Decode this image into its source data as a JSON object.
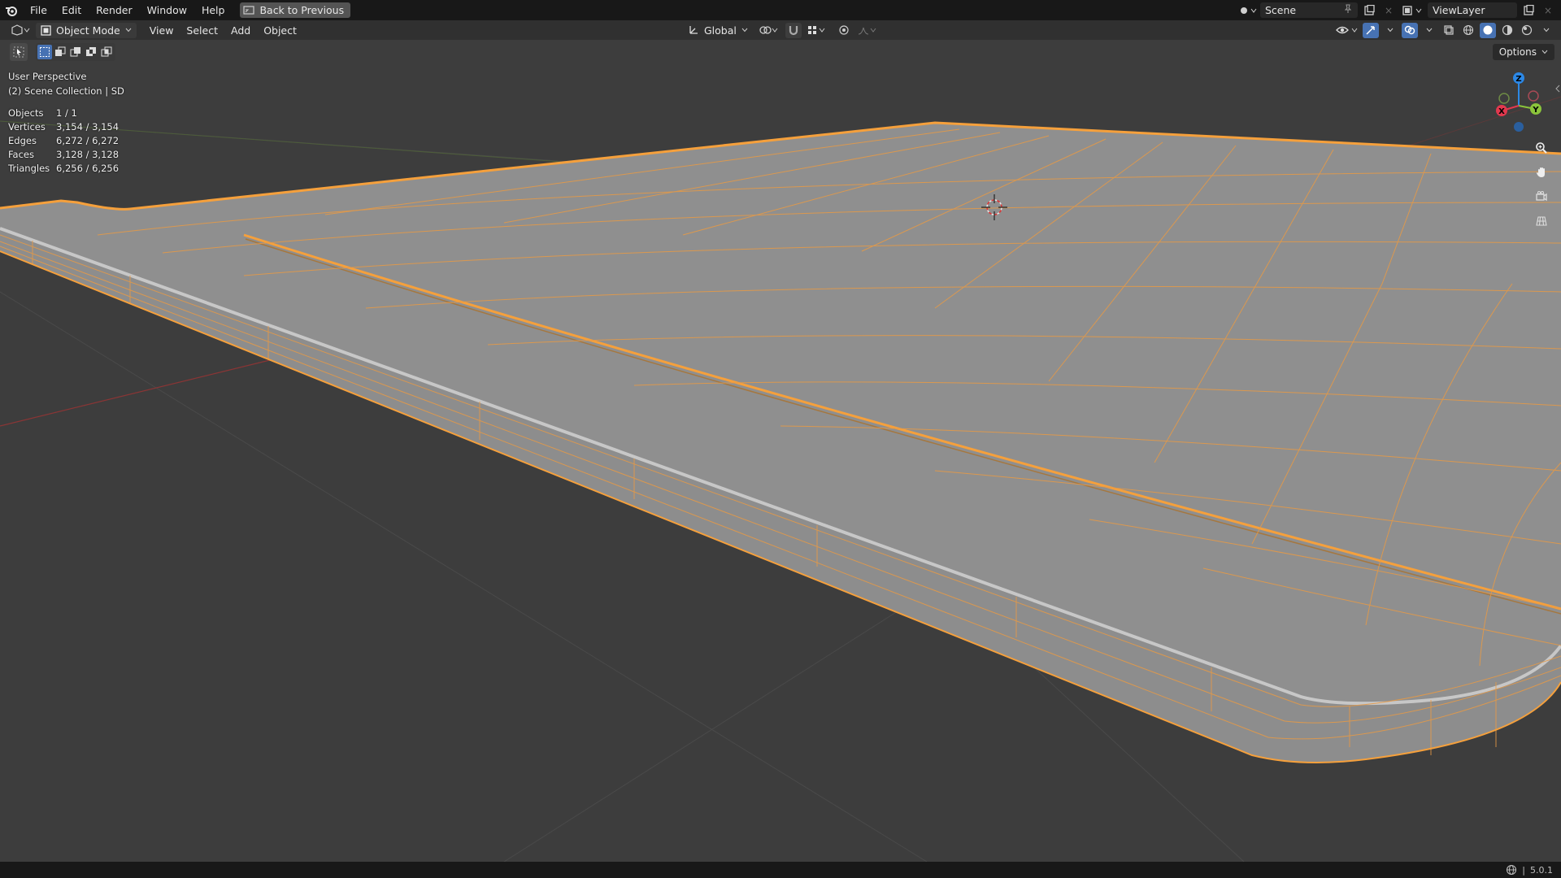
{
  "topbar": {
    "menus": [
      "File",
      "Edit",
      "Render",
      "Window",
      "Help"
    ],
    "back_label": "Back to Previous",
    "scene_name": "Scene",
    "view_layer": "ViewLayer"
  },
  "header": {
    "mode": "Object Mode",
    "menus": [
      "View",
      "Select",
      "Add",
      "Object"
    ],
    "transform_orientation": "Global",
    "options_label": "Options"
  },
  "viewport": {
    "perspective": "User Perspective",
    "collection": "(2) Scene Collection | SD",
    "stats": [
      {
        "label": "Objects",
        "value": "1 / 1"
      },
      {
        "label": "Vertices",
        "value": "3,154 / 3,154"
      },
      {
        "label": "Edges",
        "value": "6,272 / 6,272"
      },
      {
        "label": "Faces",
        "value": "3,128 / 3,128"
      },
      {
        "label": "Triangles",
        "value": "6,256 / 6,256"
      }
    ],
    "gizmo_axes": [
      "Z",
      "Y",
      "X"
    ]
  },
  "statusbar": {
    "version": "5.0.1"
  },
  "colors": {
    "accent_blue": "#4772b3",
    "selection_orange": "#f5a03c",
    "mesh_gray": "#8e8e8e",
    "axis_x": "#e2384e",
    "axis_y": "#8bc43b",
    "axis_z": "#2c88e6"
  }
}
